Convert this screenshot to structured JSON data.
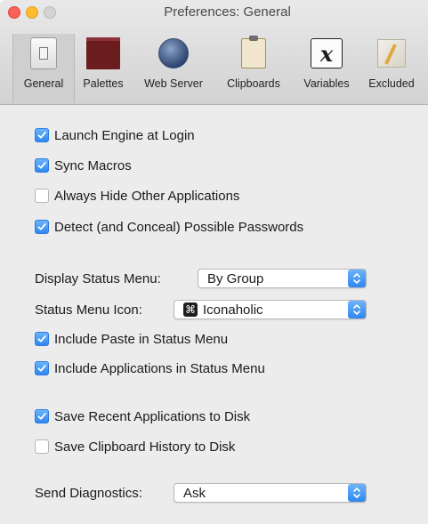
{
  "window": {
    "title": "Preferences: General"
  },
  "tabs": [
    {
      "label": "General",
      "icon": "switch-icon",
      "selected": true
    },
    {
      "label": "Palettes",
      "icon": "palette-icon",
      "selected": false
    },
    {
      "label": "Web Server",
      "icon": "globe-icon",
      "selected": false
    },
    {
      "label": "Clipboards",
      "icon": "clipboard-icon",
      "selected": false
    },
    {
      "label": "Variables",
      "icon": "variable-x-icon",
      "selected": false
    },
    {
      "label": "Excluded",
      "icon": "pencil-ruler-icon",
      "selected": false
    }
  ],
  "options": {
    "launch_engine": {
      "label": "Launch Engine at Login",
      "checked": true
    },
    "sync_macros": {
      "label": "Sync Macros",
      "checked": true
    },
    "always_hide": {
      "label": "Always Hide Other Applications",
      "checked": false
    },
    "detect_passwords": {
      "label": "Detect (and Conceal) Possible Passwords",
      "checked": true
    },
    "include_paste": {
      "label": "Include Paste in Status Menu",
      "checked": true
    },
    "include_apps": {
      "label": "Include Applications in Status Menu",
      "checked": true
    },
    "save_recent": {
      "label": "Save Recent Applications to Disk",
      "checked": true
    },
    "save_clipboard": {
      "label": "Save Clipboard History to Disk",
      "checked": false
    }
  },
  "selects": {
    "display_status_menu": {
      "label": "Display Status Menu:",
      "value": "By Group"
    },
    "status_menu_icon": {
      "label": "Status Menu Icon:",
      "value": "Iconaholic",
      "glyph": "⌘"
    },
    "send_diagnostics": {
      "label": "Send Diagnostics:",
      "value": "Ask"
    }
  },
  "colors": {
    "accent": "#2f87f0",
    "window_bg": "#ececec"
  }
}
